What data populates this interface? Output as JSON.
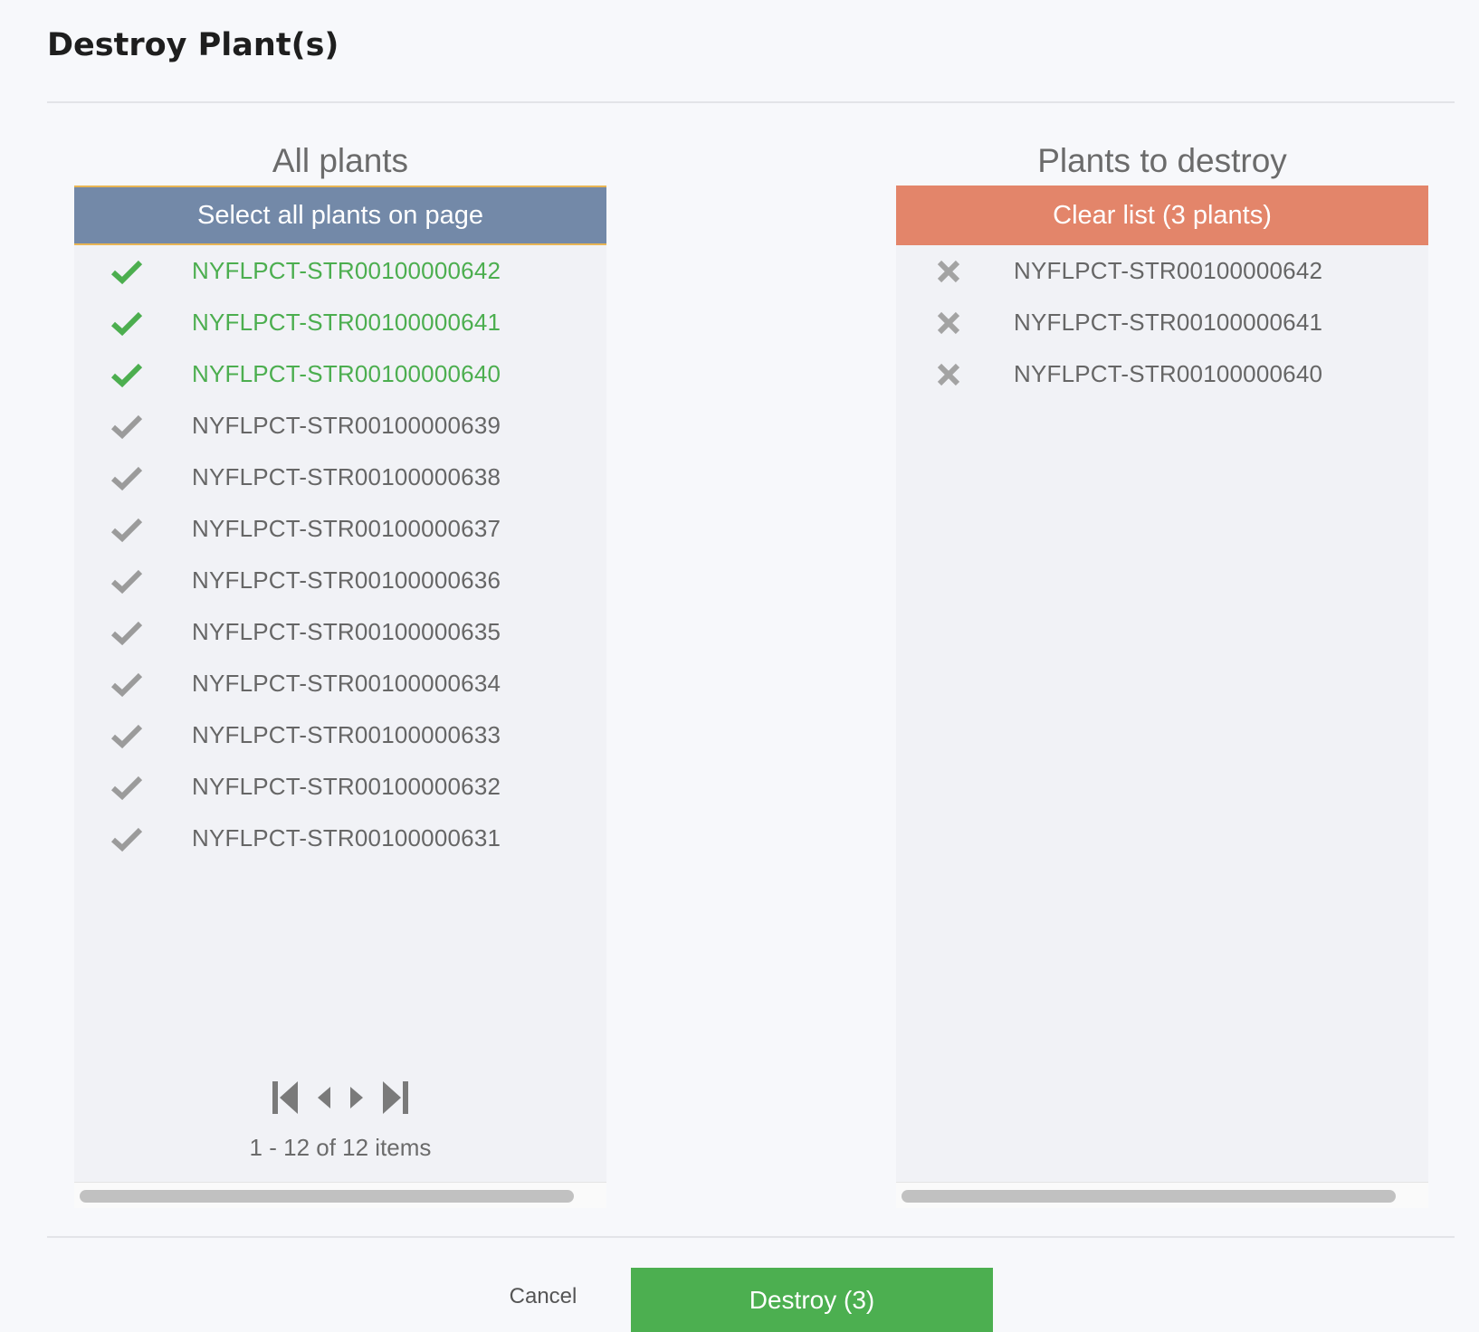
{
  "dialog": {
    "title": "Destroy Plant(s)"
  },
  "colors": {
    "selected": "#4cae4f",
    "unselected": "#9b9b9b",
    "remove": "#a3a3a3"
  },
  "all_plants": {
    "heading": "All plants",
    "select_all_label": "Select all plants on page",
    "items": [
      {
        "id": "NYFLPCT-STR00100000642",
        "selected": true
      },
      {
        "id": "NYFLPCT-STR00100000641",
        "selected": true
      },
      {
        "id": "NYFLPCT-STR00100000640",
        "selected": true
      },
      {
        "id": "NYFLPCT-STR00100000639",
        "selected": false
      },
      {
        "id": "NYFLPCT-STR00100000638",
        "selected": false
      },
      {
        "id": "NYFLPCT-STR00100000637",
        "selected": false
      },
      {
        "id": "NYFLPCT-STR00100000636",
        "selected": false
      },
      {
        "id": "NYFLPCT-STR00100000635",
        "selected": false
      },
      {
        "id": "NYFLPCT-STR00100000634",
        "selected": false
      },
      {
        "id": "NYFLPCT-STR00100000633",
        "selected": false
      },
      {
        "id": "NYFLPCT-STR00100000632",
        "selected": false
      },
      {
        "id": "NYFLPCT-STR00100000631",
        "selected": false
      }
    ],
    "pager": {
      "icons": [
        "first-page-icon",
        "prev-page-icon",
        "next-page-icon",
        "last-page-icon"
      ],
      "info": "1 - 12 of 12 items"
    }
  },
  "to_destroy": {
    "heading": "Plants to destroy",
    "clear_label": "Clear list (3 plants)",
    "items": [
      {
        "id": "NYFLPCT-STR00100000642"
      },
      {
        "id": "NYFLPCT-STR00100000641"
      },
      {
        "id": "NYFLPCT-STR00100000640"
      }
    ]
  },
  "footer": {
    "cancel_label": "Cancel",
    "destroy_label": "Destroy (3)"
  }
}
